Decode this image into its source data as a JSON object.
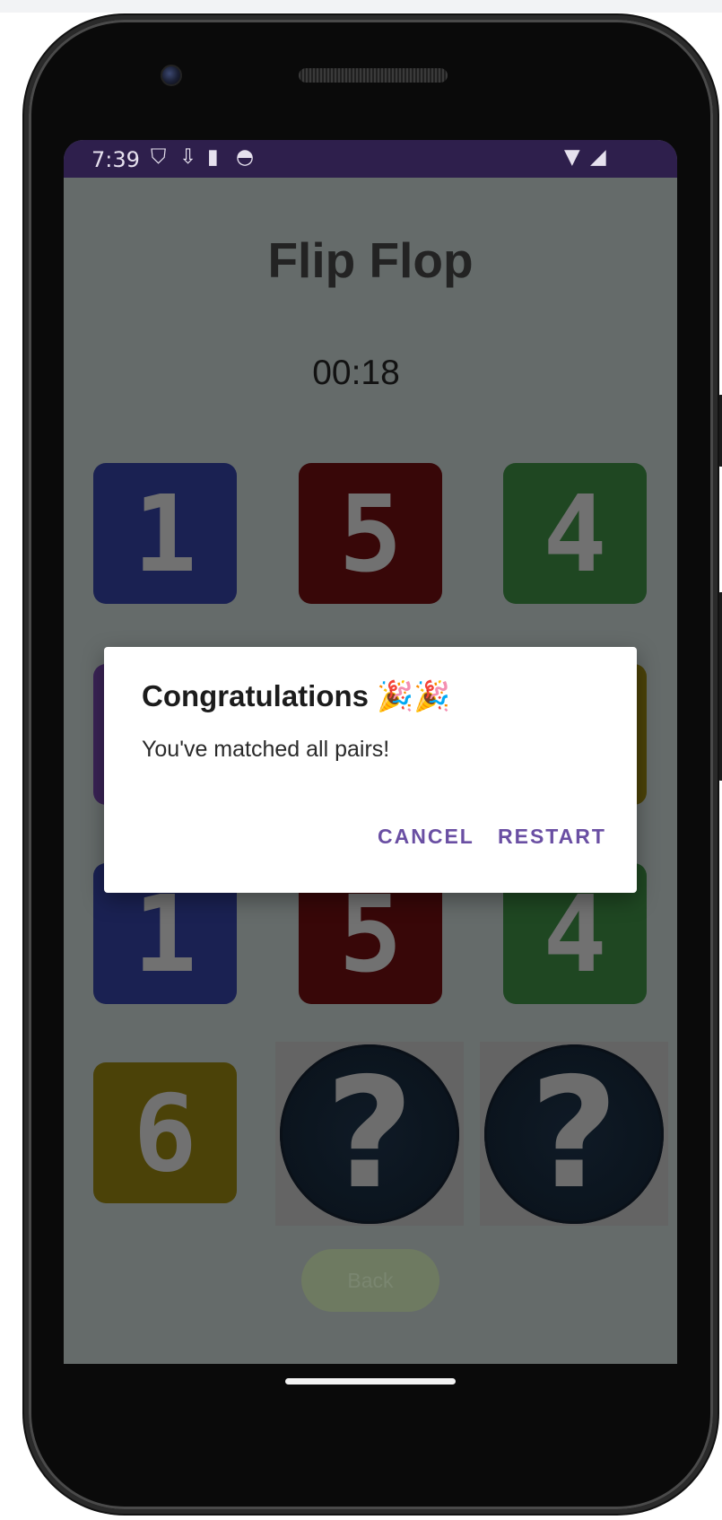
{
  "status_bar": {
    "time": "7:39",
    "icons": [
      "shield-icon",
      "download-icon",
      "sd-card-icon",
      "face-icon"
    ],
    "right_icons": [
      "wifi-icon",
      "signal-icon"
    ]
  },
  "app": {
    "title": "Flip Flop",
    "timer": "00:18"
  },
  "tiles": {
    "row1": [
      "1",
      "5",
      "4"
    ],
    "row3": [
      "1",
      "5",
      "4"
    ],
    "row4": [
      "6"
    ]
  },
  "hidden_tile_glyph": "?",
  "back_button": "Back",
  "dialog": {
    "title": "Congratulations 🎉🎉",
    "message": "You've matched all pairs!",
    "cancel": "CANCEL",
    "restart": "RESTART"
  },
  "colors": {
    "status_bar": "#2e1f4c",
    "accent": "#6a4fa3",
    "tile_blue": "#1a2152",
    "tile_red": "#380708",
    "tile_green": "#1f4722",
    "tile_yellow": "#4b4208"
  }
}
